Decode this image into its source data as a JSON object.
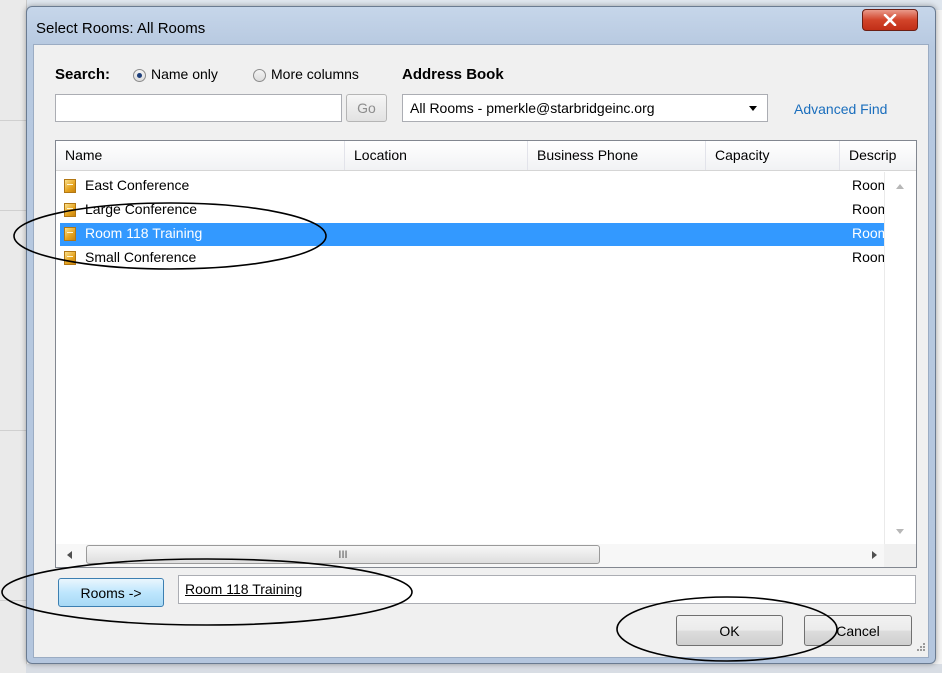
{
  "window": {
    "title": "Select Rooms: All Rooms"
  },
  "search": {
    "label": "Search:",
    "option_name_only": "Name only",
    "option_more_columns": "More columns",
    "selected_option": "Name only",
    "input_value": "",
    "go_label": "Go"
  },
  "address_book": {
    "label": "Address Book",
    "selected": "All Rooms - pmerkle@starbridgeinc.org",
    "advanced_find": "Advanced Find"
  },
  "list": {
    "columns": [
      "Name",
      "Location",
      "Business Phone",
      "Capacity",
      "Descrip"
    ],
    "rows": [
      {
        "name": "East Conference",
        "description": "Room",
        "selected": false
      },
      {
        "name": "Large Conference",
        "description": "Room",
        "selected": false
      },
      {
        "name": "Room 118 Training",
        "description": "Room",
        "selected": true
      },
      {
        "name": "Small Conference",
        "description": "Room",
        "selected": false
      }
    ],
    "hscroll_thumb_glyph": "III"
  },
  "rooms_field": {
    "button_label": "Rooms ->",
    "value": "Room 118 Training"
  },
  "buttons": {
    "ok": "OK",
    "cancel": "Cancel"
  },
  "colors": {
    "selection": "#3399ff",
    "link": "#1a6ebd",
    "close_button": "#c12f17"
  },
  "icons": {
    "close": "close-icon",
    "room": "room-icon",
    "grip": "resize-grip-icon"
  }
}
